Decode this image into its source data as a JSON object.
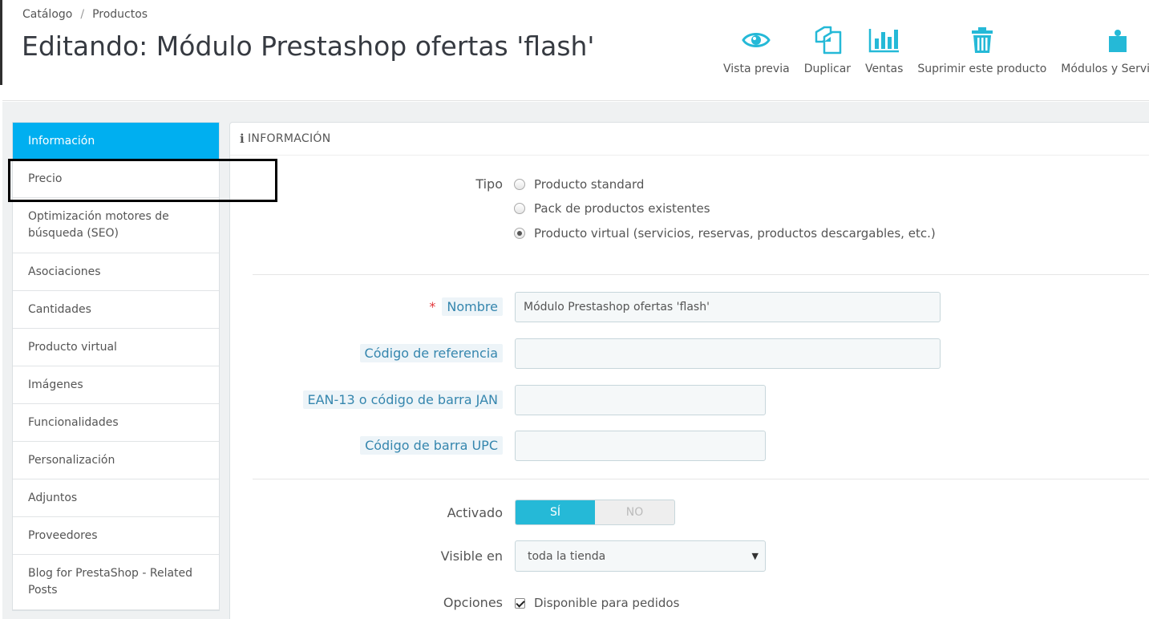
{
  "breadcrumb": [
    "Catálogo",
    "Productos"
  ],
  "breadcrumb_sep": "/",
  "page_title": "Editando: Módulo Prestashop ofertas 'flash'",
  "toolbar": [
    {
      "label": "Vista previa",
      "icon": "eye-icon"
    },
    {
      "label": "Duplicar",
      "icon": "copy-icon"
    },
    {
      "label": "Ventas",
      "icon": "bar-chart-icon"
    },
    {
      "label": "Suprimir este producto",
      "icon": "trash-icon"
    },
    {
      "label": "Módulos y Servicios",
      "icon": "puzzle-icon"
    }
  ],
  "accent_color": "#25b9d7",
  "sidebar": {
    "items": [
      {
        "label": "Información",
        "active": true
      },
      {
        "label": "Precio"
      },
      {
        "label": "Optimización motores de búsqueda (SEO)"
      },
      {
        "label": "Asociaciones"
      },
      {
        "label": "Cantidades"
      },
      {
        "label": "Producto virtual"
      },
      {
        "label": "Imágenes"
      },
      {
        "label": "Funcionalidades"
      },
      {
        "label": "Personalización"
      },
      {
        "label": "Adjuntos"
      },
      {
        "label": "Proveedores"
      },
      {
        "label": "Blog for PrestaShop - Related Posts"
      }
    ]
  },
  "panel": {
    "heading": "INFORMACIÓN",
    "tipo": {
      "label": "Tipo",
      "options": [
        {
          "label": "Producto standard",
          "checked": false
        },
        {
          "label": "Pack de productos existentes",
          "checked": false
        },
        {
          "label": "Producto virtual (servicios, reservas, productos descargables, etc.)",
          "checked": true
        }
      ]
    },
    "nombre": {
      "label": "Nombre",
      "required_mark": "*",
      "value": "Módulo Prestashop ofertas 'flash'"
    },
    "referencia": {
      "label": "Código de referencia",
      "value": ""
    },
    "ean13": {
      "label": "EAN-13 o código de barra JAN",
      "value": ""
    },
    "upc": {
      "label": "Código de barra UPC",
      "value": ""
    },
    "activado": {
      "label": "Activado",
      "on_label": "SÍ",
      "off_label": "NO",
      "value": "SÍ"
    },
    "visible": {
      "label": "Visible en",
      "value": "toda la tienda"
    },
    "opciones": {
      "label": "Opciones",
      "checkbox_label": "Disponible para pedidos",
      "checked": true
    }
  }
}
